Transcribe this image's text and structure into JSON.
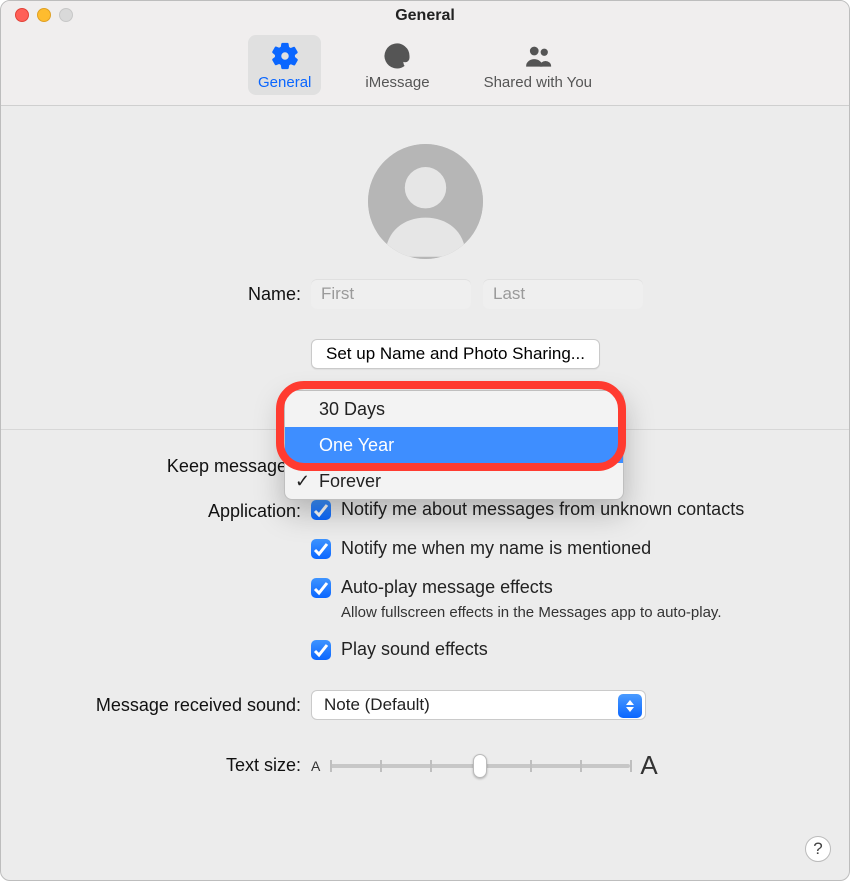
{
  "window": {
    "title": "General"
  },
  "tabs": [
    {
      "id": "general",
      "label": "General",
      "active": true
    },
    {
      "id": "imessage",
      "label": "iMessage",
      "active": false
    },
    {
      "id": "shared",
      "label": "Shared with You",
      "active": false
    }
  ],
  "name_section": {
    "label": "Name:",
    "first_placeholder": "First",
    "last_placeholder": "Last",
    "first_value": "",
    "last_value": ""
  },
  "sharing_button": "Set up Name and Photo Sharing...",
  "keep_messages": {
    "label": "Keep messages:",
    "options": [
      "30 Days",
      "One Year",
      "Forever"
    ],
    "selected": "Forever",
    "highlighted": "One Year"
  },
  "application": {
    "label": "Application:",
    "items": [
      {
        "label": "Notify me about messages from unknown contacts",
        "checked": true
      },
      {
        "label": "Notify me when my name is mentioned",
        "checked": true
      },
      {
        "label": "Auto-play message effects",
        "checked": true,
        "hint": "Allow fullscreen effects in the Messages app to auto-play."
      },
      {
        "label": "Play sound effects",
        "checked": true
      }
    ]
  },
  "sound": {
    "label": "Message received sound:",
    "value": "Note (Default)"
  },
  "textsize": {
    "label": "Text size:",
    "small_glyph": "A",
    "big_glyph": "A",
    "value_index": 3,
    "steps": 7
  },
  "help_glyph": "?"
}
